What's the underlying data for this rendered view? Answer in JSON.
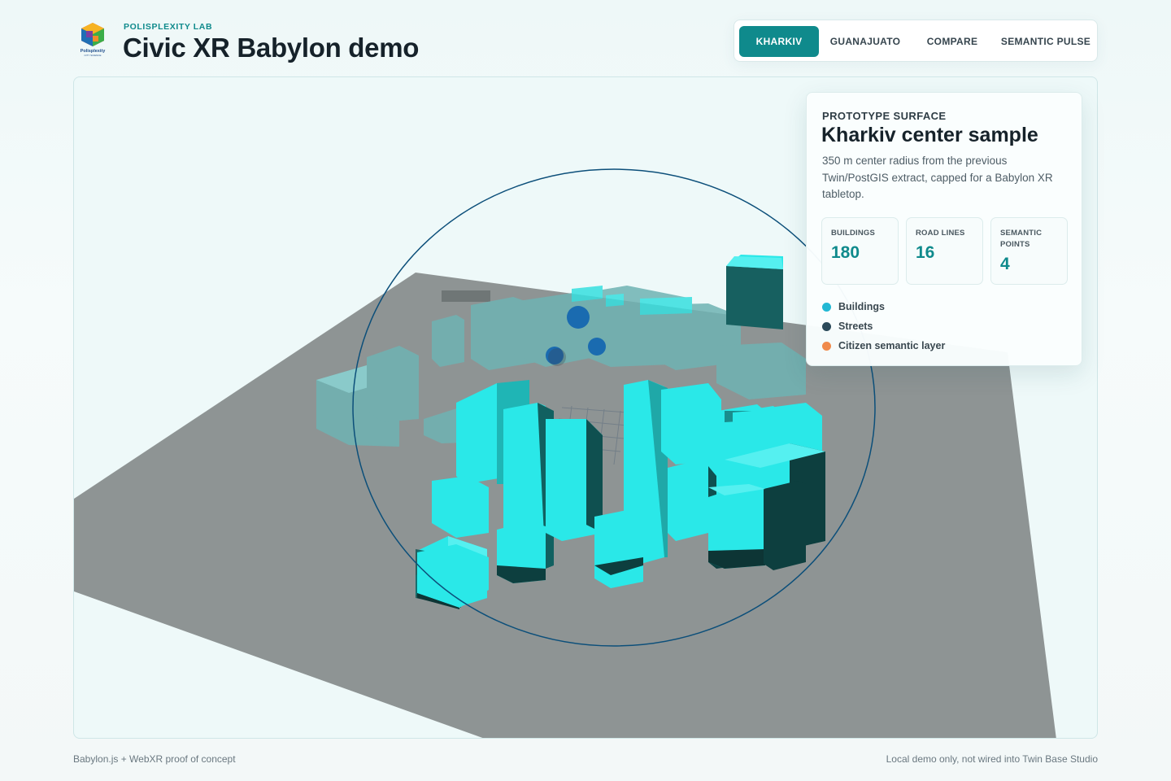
{
  "header": {
    "kicker": "POLISPLEXITY LAB",
    "title": "Civic XR Babylon demo",
    "logo_text": "Polisplexity",
    "logo_subtext": "CITY SCIENCE"
  },
  "tabs": [
    {
      "label": "KHARKIV",
      "active": true
    },
    {
      "label": "GUANAJUATO",
      "active": false
    },
    {
      "label": "COMPARE",
      "active": false
    },
    {
      "label": "SEMANTIC PULSE",
      "active": false
    }
  ],
  "panel": {
    "kicker": "PROTOTYPE SURFACE",
    "title": "Kharkiv center sample",
    "description": "350 m center radius from the previous Twin/PostGIS extract, capped for a Babylon XR tabletop.",
    "stats": [
      {
        "label": "BUILDINGS",
        "value": "180"
      },
      {
        "label": "ROAD LINES",
        "value": "16"
      },
      {
        "label": "SEMANTIC POINTS",
        "value": "4"
      }
    ],
    "legend": [
      {
        "label": "Buildings",
        "color": "#22b8d4"
      },
      {
        "label": "Streets",
        "color": "#2c4a5a"
      },
      {
        "label": "Citizen semantic layer",
        "color": "#f08a4b"
      }
    ]
  },
  "scene": {
    "ground_color": "#8e9494",
    "building_color": "#2ae8e8",
    "building_far_color": "#6fb3b3",
    "ring_color": "#0c4f7a",
    "sphere_color": "#1a6bb0",
    "background_color": "#eef9f9"
  },
  "footer": {
    "left": "Babylon.js + WebXR proof of concept",
    "right": "Local demo only, not wired into Twin Base Studio"
  }
}
